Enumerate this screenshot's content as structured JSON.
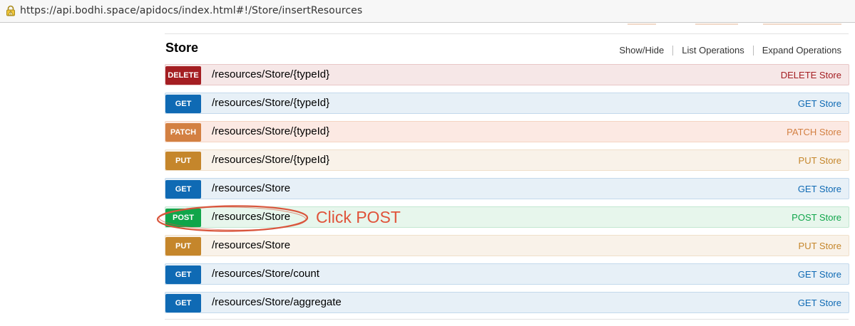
{
  "browser": {
    "url": "https://api.bodhi.space/apidocs/index.html#!/Store/insertResources",
    "lock_icon": "lock-warning-icon"
  },
  "section": {
    "title": "Store",
    "links": [
      "Show/Hide",
      "List Operations",
      "Expand Operations"
    ]
  },
  "operations": [
    {
      "method": "DELETE",
      "path": "/resources/Store/{typeId}",
      "summary": "DELETE Store"
    },
    {
      "method": "GET",
      "path": "/resources/Store/{typeId}",
      "summary": "GET Store"
    },
    {
      "method": "PATCH",
      "path": "/resources/Store/{typeId}",
      "summary": "PATCH Store"
    },
    {
      "method": "PUT",
      "path": "/resources/Store/{typeId}",
      "summary": "PUT Store"
    },
    {
      "method": "GET",
      "path": "/resources/Store",
      "summary": "GET Store"
    },
    {
      "method": "POST",
      "path": "/resources/Store",
      "summary": "POST Store"
    },
    {
      "method": "PUT",
      "path": "/resources/Store",
      "summary": "PUT Store"
    },
    {
      "method": "GET",
      "path": "/resources/Store/count",
      "summary": "GET Store"
    },
    {
      "method": "GET",
      "path": "/resources/Store/aggregate",
      "summary": "GET Store"
    }
  ],
  "annotation": {
    "text": "Click POST",
    "color": "#e0533a"
  },
  "colors": {
    "DELETE": "#a41e22",
    "GET": "#0f6ab4",
    "PATCH": "#d38042",
    "PUT": "#c5862b",
    "POST": "#10a54a"
  }
}
